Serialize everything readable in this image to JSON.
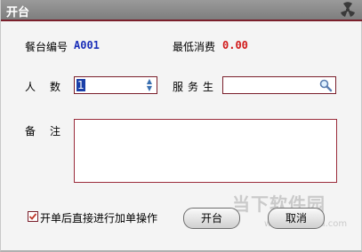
{
  "window": {
    "title": "开台"
  },
  "form": {
    "table_no_label": "餐台编号",
    "table_no_value": "A001",
    "min_charge_label": "最低消费",
    "min_charge_value": "0.00",
    "people_label": "人　数",
    "people_value": "1",
    "waiter_label": "服务生",
    "waiter_value": "",
    "note_label": "备　注",
    "note_value": ""
  },
  "options": {
    "add_after_open_label": "开单后直接进行加单操作",
    "add_after_open_checked": true
  },
  "buttons": {
    "open_label": "开台",
    "cancel_label": "取消"
  },
  "watermark": {
    "text": "当下软件园",
    "url": "www.downxia.com"
  },
  "icons": {
    "title_button": "radiation-icon",
    "search": "magnifier-icon",
    "spin_up": "chevron-up-icon",
    "spin_down": "chevron-down-icon"
  },
  "colors": {
    "accent": "#7a1f2b",
    "value_blue": "#1b2fb8",
    "value_red": "#d11a1a"
  }
}
